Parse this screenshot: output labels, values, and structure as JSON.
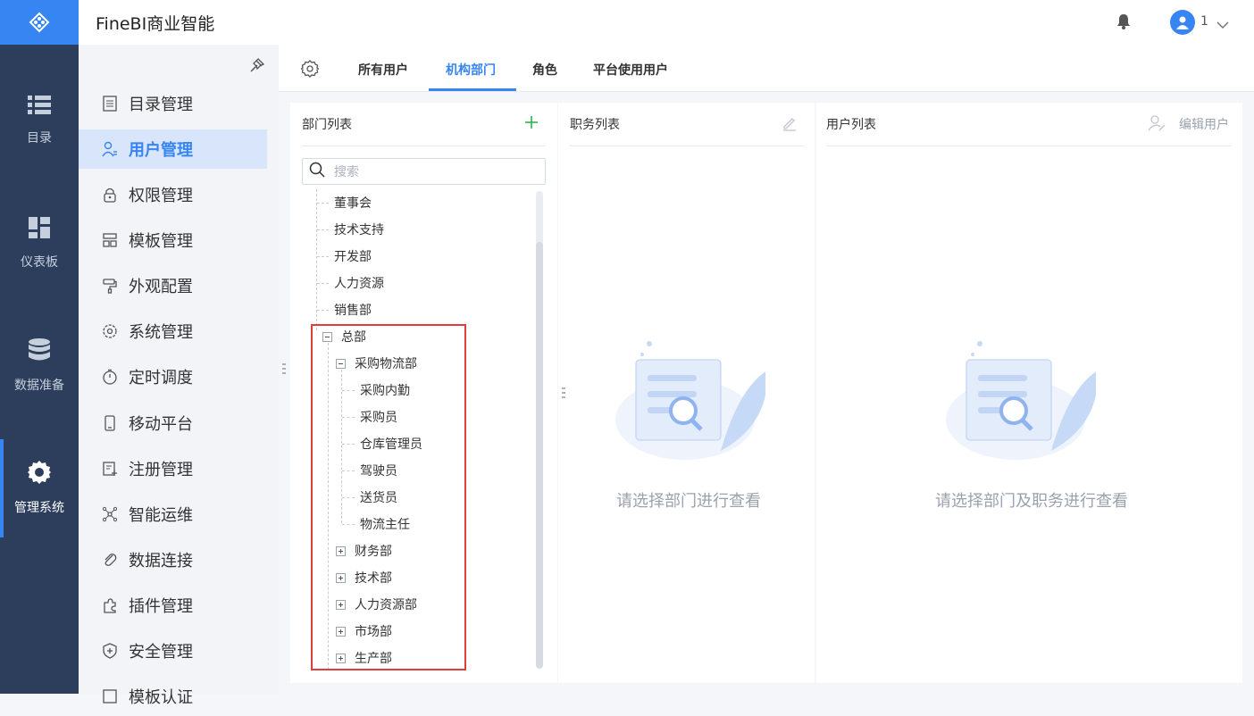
{
  "app": {
    "title": "FineBI商业智能"
  },
  "user": {
    "name": "1"
  },
  "rail": [
    {
      "label": "目录",
      "icon": "list-icon"
    },
    {
      "label": "仪表板",
      "icon": "dashboard-icon"
    },
    {
      "label": "数据准备",
      "icon": "database-icon"
    },
    {
      "label": "管理系统",
      "icon": "gear-icon"
    }
  ],
  "menu": [
    {
      "label": "目录管理",
      "icon": "catalog-icon"
    },
    {
      "label": "用户管理",
      "icon": "user-icon"
    },
    {
      "label": "权限管理",
      "icon": "lock-icon"
    },
    {
      "label": "模板管理",
      "icon": "template-icon"
    },
    {
      "label": "外观配置",
      "icon": "paint-roller-icon"
    },
    {
      "label": "系统管理",
      "icon": "settings-icon"
    },
    {
      "label": "定时调度",
      "icon": "timer-icon"
    },
    {
      "label": "移动平台",
      "icon": "mobile-icon"
    },
    {
      "label": "注册管理",
      "icon": "register-icon"
    },
    {
      "label": "智能运维",
      "icon": "ops-icon"
    },
    {
      "label": "数据连接",
      "icon": "link-icon"
    },
    {
      "label": "插件管理",
      "icon": "plugin-icon"
    },
    {
      "label": "安全管理",
      "icon": "shield-icon"
    },
    {
      "label": "模板认证",
      "icon": "cert-icon"
    }
  ],
  "tabs": [
    "所有用户",
    "机构部门",
    "角色",
    "平台使用用户"
  ],
  "panels": {
    "dept": {
      "title": "部门列表"
    },
    "duty": {
      "title": "职务列表",
      "empty": "请选择部门进行查看"
    },
    "users": {
      "title": "用户列表",
      "edit": "编辑用户",
      "empty": "请选择部门及职务进行查看"
    }
  },
  "search": {
    "placeholder": "搜索"
  },
  "tree": [
    {
      "label": "董事会",
      "level": 1,
      "toggle": "none"
    },
    {
      "label": "技术支持",
      "level": 1,
      "toggle": "none"
    },
    {
      "label": "开发部",
      "level": 1,
      "toggle": "none"
    },
    {
      "label": "人力资源",
      "level": 1,
      "toggle": "none"
    },
    {
      "label": "销售部",
      "level": 1,
      "toggle": "none"
    },
    {
      "label": "总部",
      "level": 1,
      "toggle": "minus"
    },
    {
      "label": "采购物流部",
      "level": 2,
      "toggle": "minus"
    },
    {
      "label": "采购内勤",
      "level": 3,
      "toggle": "none"
    },
    {
      "label": "采购员",
      "level": 3,
      "toggle": "none"
    },
    {
      "label": "仓库管理员",
      "level": 3,
      "toggle": "none"
    },
    {
      "label": "驾驶员",
      "level": 3,
      "toggle": "none"
    },
    {
      "label": "送货员",
      "level": 3,
      "toggle": "none"
    },
    {
      "label": "物流主任",
      "level": 3,
      "toggle": "none"
    },
    {
      "label": "财务部",
      "level": 2,
      "toggle": "plus"
    },
    {
      "label": "技术部",
      "level": 2,
      "toggle": "plus"
    },
    {
      "label": "人力资源部",
      "level": 2,
      "toggle": "plus"
    },
    {
      "label": "市场部",
      "level": 2,
      "toggle": "plus"
    },
    {
      "label": "生产部",
      "level": 2,
      "toggle": "plus"
    }
  ]
}
